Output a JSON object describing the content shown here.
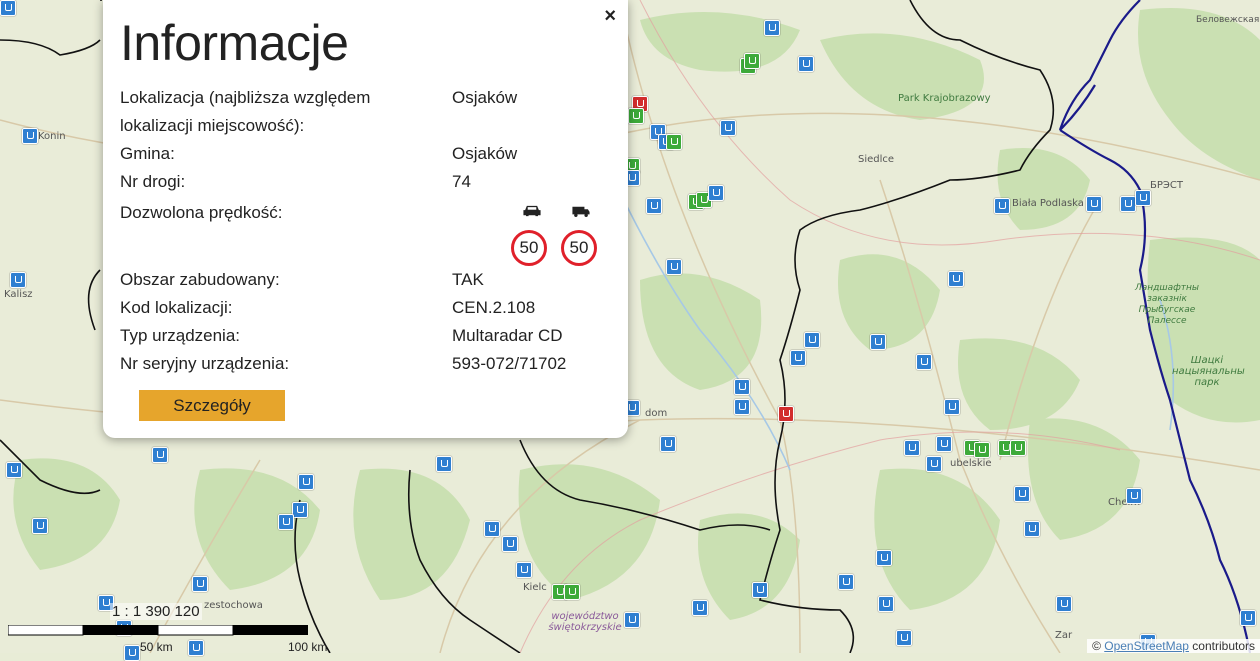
{
  "popup": {
    "title": "Informacje",
    "close_symbol": "×",
    "rows": [
      {
        "label": "Lokalizacja (najbliższa względem lokalizacji miejscowość):",
        "value": "Osjaków"
      },
      {
        "label": "Gmina:",
        "value": "Osjaków"
      },
      {
        "label": "Nr drogi:",
        "value": "74"
      },
      {
        "label": "Dozwolona prędkość:",
        "value": ""
      },
      {
        "label": "Obszar zabudowany:",
        "value": "TAK"
      },
      {
        "label": "Kod lokalizacji:",
        "value": "CEN.2.108"
      },
      {
        "label": "Typ urządzenia:",
        "value": "Multaradar CD"
      },
      {
        "label": "Nr seryjny urządzenia:",
        "value": "593-072/71702"
      }
    ],
    "speed_limits": {
      "car_icon": "car-icon",
      "truck_icon": "truck-icon",
      "car": "50",
      "truck": "50"
    },
    "details_button": "Szczegóły"
  },
  "map": {
    "places": {
      "konin": "Konin",
      "kalisz": "Kalisz",
      "siedlce": "Siedlce",
      "biala_podlaska": "Biała Podlaska",
      "brest": "БРЭСТ",
      "belovezhskaya": "Беловежская",
      "park_krajobrazowy": "Park Krajobrazowy",
      "lubelskie": "ubelskie",
      "chelm": "Chełm",
      "zamosc": "Zar",
      "kielce": "Kielc",
      "czestochowa": "zestochowa",
      "radom": "dom",
      "region_swietokrzyskie": "województwo świętokrzyskie",
      "shatsk": "Шацкі нацыянальны парк",
      "zakaznik": "Ландшафтны заказнік Прыбугскае Палессе"
    },
    "scale_label": "1 : 1 390 120",
    "scale_ticks": [
      "50 km",
      "100 km"
    ],
    "attribution_prefix": "© ",
    "attribution_link": "OpenStreetMap",
    "attribution_suffix": " contributors",
    "colors": {
      "border_national": "#1a1a8a",
      "border_region": "#111111",
      "marker_blue": "#2f7fd1",
      "marker_green": "#3daa3a",
      "marker_red": "#d22d2d",
      "button": "#e6a52c",
      "sign_ring": "#e0202a"
    }
  }
}
